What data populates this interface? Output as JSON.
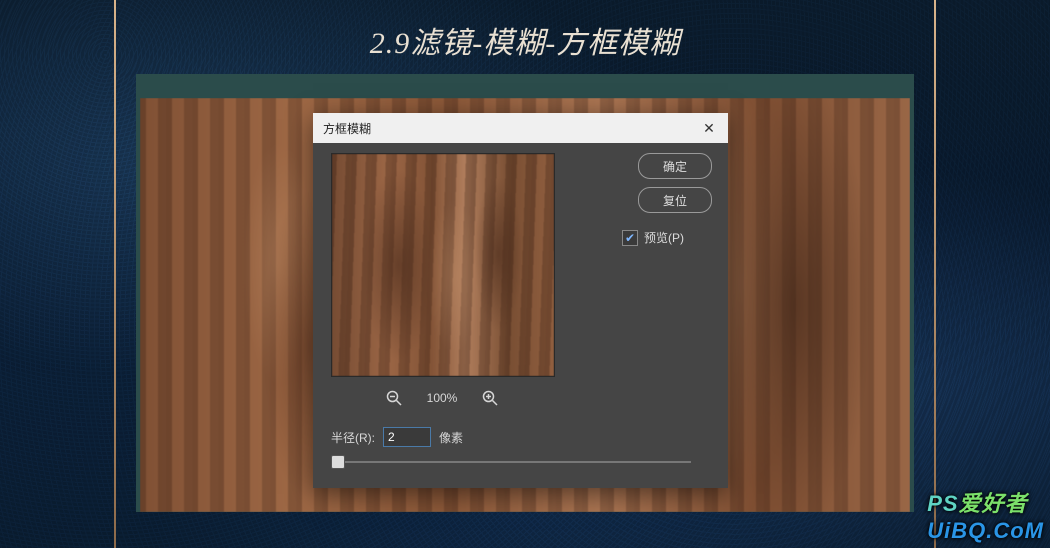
{
  "page_title": "2.9滤镜-模糊-方框模糊",
  "dialog": {
    "title": "方框模糊",
    "close_glyph": "✕",
    "ok_label": "确定",
    "reset_label": "复位",
    "preview_label": "预览(P)",
    "preview_checked": true,
    "zoom_out_name": "zoom-out-icon",
    "zoom_in_name": "zoom-in-icon",
    "zoom_level": "100%",
    "radius_label": "半径(R):",
    "radius_value": "2",
    "radius_unit": "像素"
  },
  "watermark": {
    "part1": "PS",
    "part2": "爱好者",
    "url": "UiBQ.CoM"
  },
  "colors": {
    "dark_bg": "#0a1a2a",
    "panel_teal": "#2b4c4b",
    "dialog_bg": "#454545",
    "titlebar_bg": "#f0f0f0",
    "input_border": "#4a7aa8"
  }
}
